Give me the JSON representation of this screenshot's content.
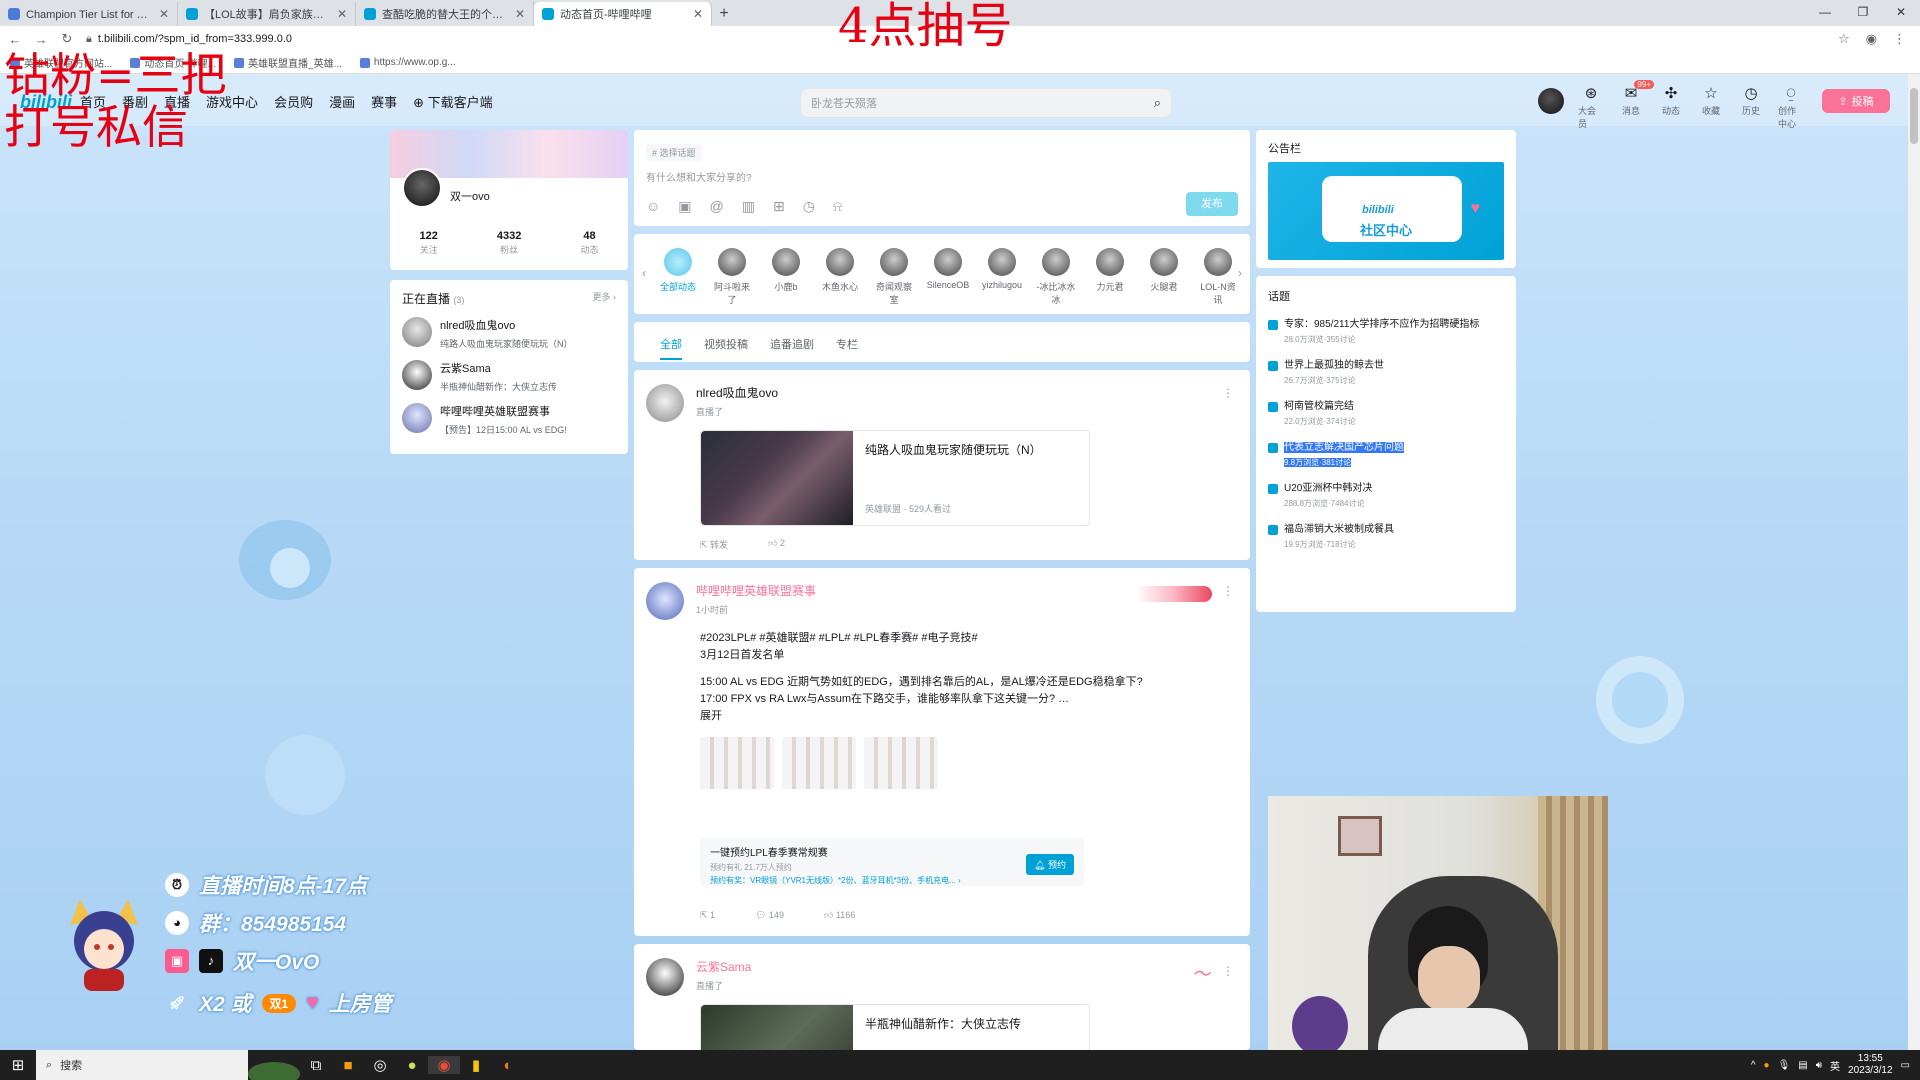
{
  "browser": {
    "tabs": [
      {
        "title": "Champion Tier List for 下路, 分...",
        "active": false
      },
      {
        "title": "【LOL故事】肩负家族的暴心小...",
        "active": false
      },
      {
        "title": "查酷吃脆的替大王的个人空间_哔...",
        "active": false
      },
      {
        "title": "动态首页-哔哩哔哩",
        "active": true
      }
    ],
    "new_tab": "+",
    "url": "t.bilibili.com/?spm_id_from=333.999.0.0",
    "bookmarks": [
      "英雄联盟官方网站...",
      "动态首页-哔哩...",
      "英雄联盟直播_英雄...",
      "https://www.op.g..."
    ],
    "window_controls": [
      "—",
      "❐",
      "✕"
    ]
  },
  "overlay": {
    "top_center": "4点抽号",
    "top_left_line1": "钻粉=三把",
    "top_left_line2": "打号私信",
    "live_time": "直播时间8点-17点",
    "qq_group": "群：854985154",
    "douyin": "双一OvO",
    "gift_prefix": "X2 或",
    "gift_pill": "双1",
    "gift_suffix": "上房管"
  },
  "header": {
    "logo": "bilibili",
    "nav": [
      "首页",
      "番剧",
      "直播",
      "游戏中心",
      "会员购",
      "漫画",
      "赛事",
      "下载客户端"
    ],
    "search_placeholder": "卧龙苍天殒落",
    "icons": [
      {
        "label": "大会员",
        "icon": "vip-icon"
      },
      {
        "label": "消息",
        "icon": "message-icon",
        "badge": "99+"
      },
      {
        "label": "动态",
        "icon": "dynamic-icon"
      },
      {
        "label": "收藏",
        "icon": "star-icon"
      },
      {
        "label": "历史",
        "icon": "history-icon"
      },
      {
        "label": "创作中心",
        "icon": "bulb-icon"
      }
    ],
    "upload": "投稿"
  },
  "profile": {
    "name": "双一ovo",
    "stats": [
      {
        "value": "122",
        "label": "关注"
      },
      {
        "value": "4332",
        "label": "粉丝"
      },
      {
        "value": "48",
        "label": "动态"
      }
    ]
  },
  "live": {
    "title": "正在直播",
    "count": "(3)",
    "more": "更多 ›",
    "items": [
      {
        "name": "nlred吸血鬼ovo",
        "desc": "纯路人吸血鬼玩家随便玩玩（N）"
      },
      {
        "name": "云紫Sama",
        "desc": "半瓶神仙醋新作：大侠立志传"
      },
      {
        "name": "哔哩哔哩英雄联盟赛事",
        "desc": "【预告】12日15:00 AL vs EDG!"
      }
    ]
  },
  "composer": {
    "topic_btn": "选择话题",
    "placeholder": "有什么想和大家分享的?",
    "publish": "发布"
  },
  "following": [
    {
      "name": "全部动态",
      "active": true
    },
    {
      "name": "阿斗啦来了"
    },
    {
      "name": "小鹿b"
    },
    {
      "name": "木鱼水心"
    },
    {
      "name": "奇闻观察室"
    },
    {
      "name": "SilenceOB"
    },
    {
      "name": "yizhilugou"
    },
    {
      "name": "-冰比冰水冰"
    },
    {
      "name": "力元君"
    },
    {
      "name": "火腿君"
    },
    {
      "name": "LOL-N资讯"
    }
  ],
  "feed_tabs": [
    "全部",
    "视频投稿",
    "追番追剧",
    "专栏"
  ],
  "posts": {
    "p1": {
      "name": "nlred吸血鬼ovo",
      "meta": "直播了",
      "video_title": "纯路人吸血鬼玩家随便玩玩（N）",
      "video_sub": "英雄联盟 · 529人看过",
      "forward": "转发",
      "likes": "2"
    },
    "p2": {
      "name": "哔哩哔哩英雄联盟赛事",
      "meta": "1小时前",
      "topics": "#2023LPL# #英雄联盟# #LPL# #LPL春季赛# #电子竞技#",
      "line1": "3月12日首发名单",
      "line2": "15:00 AL vs EDG 近期气势如虹的EDG，遇到排名靠后的AL，是AL爆冷还是EDG稳稳拿下?",
      "line3": "17:00 FPX vs RA Lwx与Assum在下路交手，谁能够率队拿下这关键一分? …",
      "expand": "展开",
      "resv_title": "一键预约LPL春季赛常规赛",
      "resv_sub": "预约有礼 21.7万人预约",
      "resv_prize": "预约有奖：VR眼镜（YVR1无线版）*2份、蓝牙耳机*3份、手机充电... ›",
      "resv_btn": "预约",
      "forwards": "1",
      "comments": "149",
      "likes": "1166"
    },
    "p3": {
      "name": "云紫Sama",
      "meta": "直播了",
      "video_title": "半瓶神仙醋新作：大侠立志传"
    }
  },
  "notice": {
    "title": "公告栏",
    "banner_text": "社区中心",
    "banner_logo": "bilibili"
  },
  "topics": {
    "title": "话题",
    "items": [
      {
        "text": "专家：985/211大学排序不应作为招聘硬指标",
        "stat": "28.0万浏览·355讨论"
      },
      {
        "text": "世界上最孤独的鲸去世",
        "stat": "26.7万浏览·375讨论"
      },
      {
        "text": "柯南管校篇完结",
        "stat": "22.0万浏览·374讨论"
      },
      {
        "text": "代表立志解决国产芯片问题",
        "stat": "9.8万浏览·381讨论",
        "highlighted": true
      },
      {
        "text": "U20亚洲杯中韩对决",
        "stat": "288.8万浏览·7484讨论"
      },
      {
        "text": "福岛滞销大米被制成餐具",
        "stat": "19.9万浏览·718讨论"
      }
    ]
  },
  "taskbar": {
    "search": "搜索",
    "ime": "英",
    "time": "13:55",
    "date": "2023/3/12"
  },
  "colors": {
    "bili_blue": "#00a1d6",
    "bili_pink": "#fb7299",
    "overlay_red": "#e60012"
  }
}
